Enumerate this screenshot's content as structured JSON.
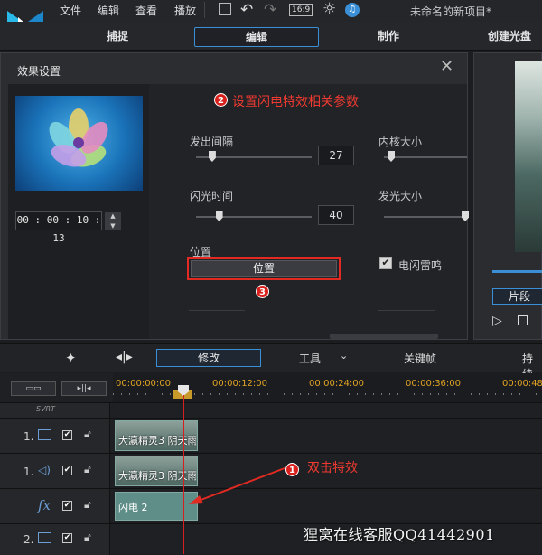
{
  "menu": {
    "items": [
      "文件",
      "编辑",
      "查看",
      "播放"
    ],
    "project_title": "未命名的新项目*",
    "aspect_ratio": "16:9"
  },
  "modes": {
    "tabs": [
      "捕捉",
      "编辑",
      "制作",
      "创建光盘"
    ],
    "active": "编辑"
  },
  "dialog": {
    "title": "效果设置",
    "timecode": "00 : 00 : 10 : 13",
    "annotation_2": "设置闪电特效相关参数",
    "params": {
      "interval_label": "发出间隔",
      "interval_value": "27",
      "interval_level": 0.14,
      "flash_label": "闪光时间",
      "flash_value": "40",
      "flash_level": 0.2,
      "core_label": "内核大小",
      "glow_label": "发光大小",
      "position_label": "位置",
      "position_button": "位置",
      "thunder_label": "电闪雷鸣",
      "thunder_checked": true
    },
    "badge_2": "2",
    "badge_3": "3"
  },
  "preview": {
    "segment_label": "片段"
  },
  "toolbar": {
    "modify": "修改",
    "tools": "工具",
    "keyframe": "关键帧",
    "duration": "持续"
  },
  "timeline": {
    "ticks": [
      "00:00:00:00",
      "00:00:12:00",
      "00:00:24:00",
      "00:00:36:00",
      "00:00:48:0"
    ],
    "svrt": "SVRT",
    "tracks": [
      {
        "num": "1.",
        "type": "video",
        "clip": "大瀛精灵3 阴天雨"
      },
      {
        "num": "1.",
        "type": "audio",
        "clip": "大瀛精灵3 阴天雨"
      },
      {
        "num": "",
        "type": "fx",
        "fx_label": "fx",
        "clip": "闪电 2"
      },
      {
        "num": "2.",
        "type": "video",
        "clip": ""
      }
    ],
    "annotation_1": "双击特效",
    "badge_1": "1"
  },
  "watermark": "狸窝在线客服QQ41442901",
  "colors": {
    "accent": "#3b8fd6",
    "annotation": "#e02a22",
    "playhead": "#d62020"
  }
}
